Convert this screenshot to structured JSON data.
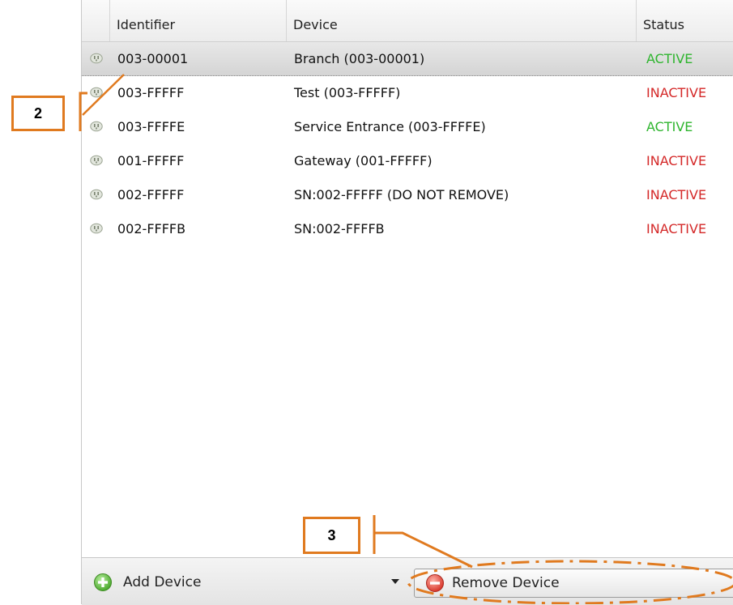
{
  "table": {
    "columns": {
      "identifier": "Identifier",
      "device": "Device",
      "status": "Status"
    },
    "rows": [
      {
        "identifier": "003-00001",
        "device": "Branch (003-00001)",
        "status": "ACTIVE",
        "status_color": "#2fb52f",
        "selected": true
      },
      {
        "identifier": "003-FFFFF",
        "device": "Test (003-FFFFF)",
        "status": "INACTIVE",
        "status_color": "#d42828",
        "selected": false
      },
      {
        "identifier": "003-FFFFE",
        "device": "Service Entrance (003-FFFFE)",
        "status": "ACTIVE",
        "status_color": "#2fb52f",
        "selected": false
      },
      {
        "identifier": "001-FFFFF",
        "device": "Gateway (001-FFFFF)",
        "status": "INACTIVE",
        "status_color": "#d42828",
        "selected": false
      },
      {
        "identifier": "002-FFFFF",
        "device": "SN:002-FFFFF (DO NOT REMOVE)",
        "status": "INACTIVE",
        "status_color": "#d42828",
        "selected": false
      },
      {
        "identifier": "002-FFFFB",
        "device": "SN:002-FFFFB",
        "status": "INACTIVE",
        "status_color": "#d42828",
        "selected": false
      }
    ],
    "row_icon": "device-plug-icon"
  },
  "toolbar": {
    "add_label": "Add Device",
    "add_icon": "plus-circle-icon",
    "dropdown_icon": "caret-down-icon",
    "remove_label": "Remove Device",
    "remove_icon": "minus-circle-icon"
  },
  "callouts": {
    "step2": "2",
    "step3": "3",
    "color": "#e07a1f"
  }
}
